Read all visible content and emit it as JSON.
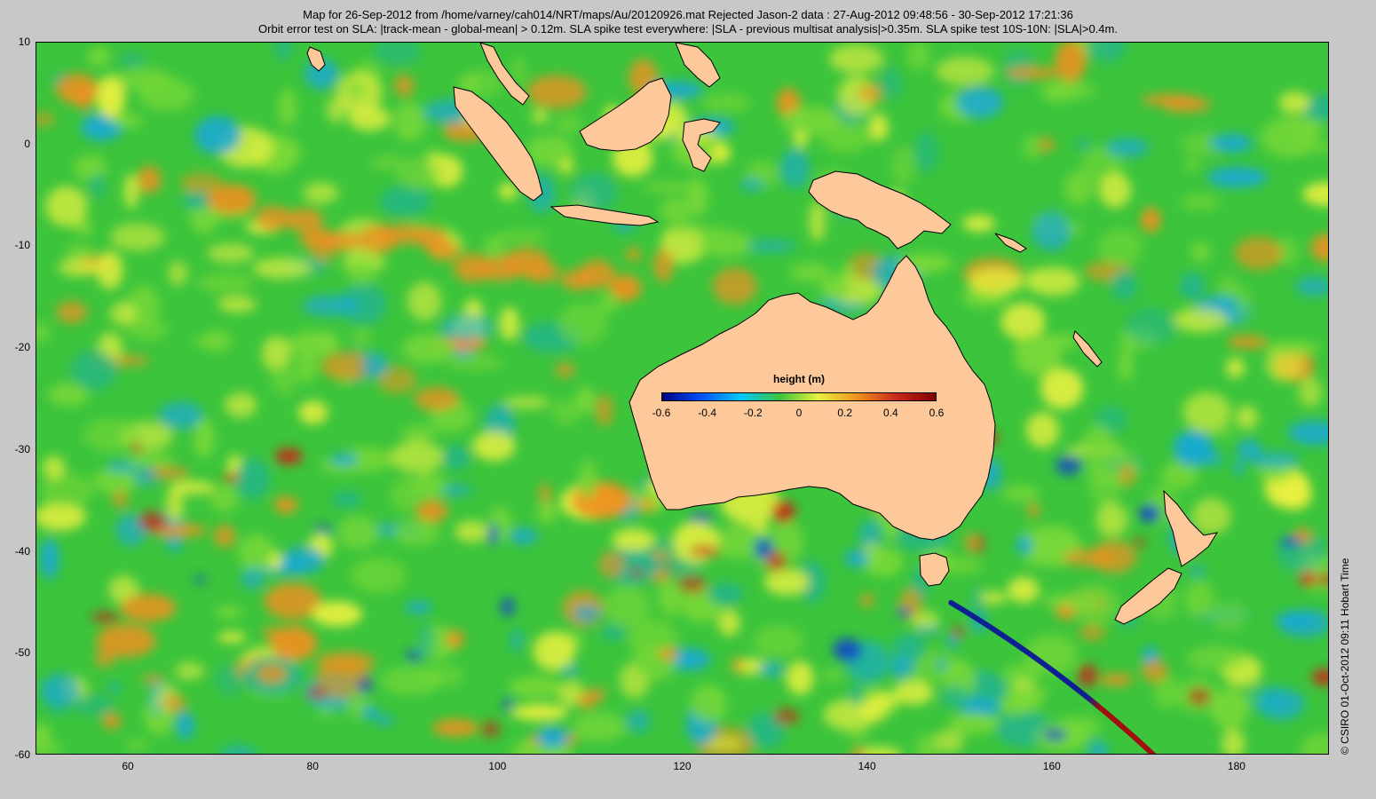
{
  "title": {
    "line1": "Map for 26-Sep-2012 from /home/varney/cah014/NRT/maps/Au/20120926.mat  Rejected Jason-2 data : 27-Aug-2012 09:48:56 - 30-Sep-2012 17:21:36",
    "line2": "Orbit error test on SLA: |track-mean  - global-mean| > 0.12m.  SLA spike test everywhere: |SLA - previous multisat analysis|>0.35m. SLA spike test 10S-10N: |SLA|>0.4m."
  },
  "axes": {
    "x_ticks": [
      "60",
      "80",
      "100",
      "120",
      "140",
      "160",
      "180"
    ],
    "y_ticks": [
      "10",
      "0",
      "-10",
      "-20",
      "-30",
      "-40",
      "-50",
      "-60"
    ]
  },
  "colorbar": {
    "label": "height (m)",
    "ticks": [
      "-0.6",
      "-0.4",
      "-0.2",
      "0",
      "0.2",
      "0.4",
      "0.6"
    ]
  },
  "credit": "© CSIRO 01-Oct-2012 09:11 Hobart Time",
  "colors": {
    "land": "#fdc99a",
    "sea_base": "#3cc43c",
    "sea_green_light": "#78d838",
    "sea_yellow": "#e8f040",
    "sea_teal": "#22b48c",
    "sea_cyan": "#18a8d8",
    "sea_blue": "#1040d0",
    "sea_orange": "#f09020",
    "sea_red": "#c82818",
    "track_blue": "#102090",
    "track_red": "#a01010"
  },
  "chart_data": {
    "type": "heatmap",
    "xlim": [
      50,
      190
    ],
    "ylim": [
      -60,
      10
    ],
    "clim": [
      -0.6,
      0.6
    ],
    "title": "Map for 26-Sep-2012 from /home/varney/cah014/NRT/maps/Au/20120926.mat  Rejected Jason-2 data : 27-Aug-2012 09:48:56 - 30-Sep-2012 17:21:36",
    "colorbar_label": "height (m)",
    "rejected_track": {
      "start": [
        149,
        -45
      ],
      "end": [
        171,
        -60
      ]
    }
  }
}
